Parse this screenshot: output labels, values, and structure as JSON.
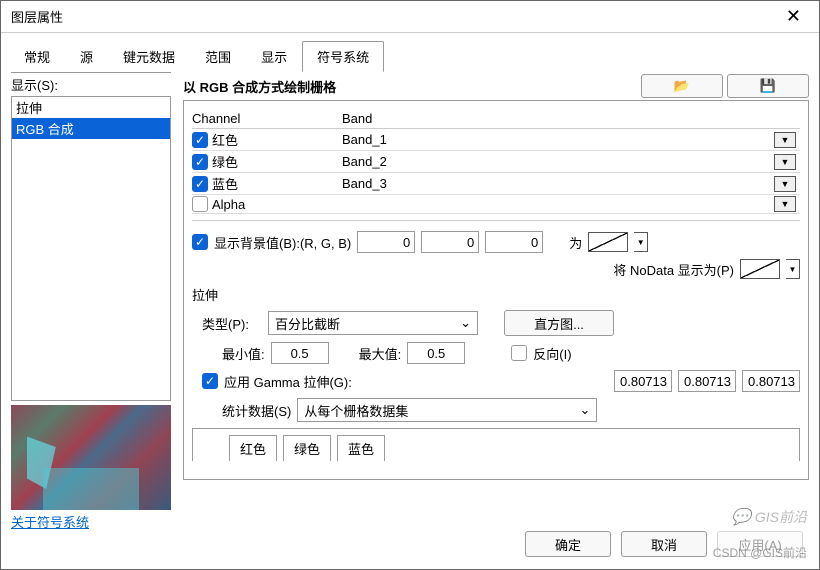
{
  "title": "图层属性",
  "tabs": [
    "常规",
    "源",
    "键元数据",
    "范围",
    "显示",
    "符号系统"
  ],
  "active_tab": "符号系统",
  "left_label": "显示(S):",
  "display_list": [
    "拉伸",
    "RGB 合成"
  ],
  "about_link": "关于符号系统",
  "panel_title": "以 RGB 合成方式绘制栅格",
  "channel_hdr": {
    "c1": "Channel",
    "c2": "Band"
  },
  "channels": [
    {
      "checked": true,
      "name": "红色",
      "band": "Band_1"
    },
    {
      "checked": true,
      "name": "绿色",
      "band": "Band_2"
    },
    {
      "checked": true,
      "name": "蓝色",
      "band": "Band_3"
    },
    {
      "checked": false,
      "name": "Alpha",
      "band": ""
    }
  ],
  "bg": {
    "chk": true,
    "label": "显示背景值(B):(R, G, B)",
    "r": "0",
    "g": "0",
    "b": "0",
    "as": "为"
  },
  "nodata_label": "将 NoData 显示为(P)",
  "stretch_label": "拉伸",
  "type_label": "类型(P):",
  "type_value": "百分比截断",
  "hist_btn": "直方图...",
  "min_label": "最小值:",
  "min_val": "0.5",
  "max_label": "最大值:",
  "max_val": "0.5",
  "invert_label": "反向(I)",
  "gamma": {
    "chk": true,
    "label": "应用 Gamma 拉伸(G):",
    "v1": "0.80713",
    "v2": "0.80713",
    "v3": "0.80713"
  },
  "stats_label": "统计数据(S)",
  "stats_combo": "从每个栅格数据集",
  "stat_tabs": [
    "红色",
    "绿色",
    "蓝色"
  ],
  "ok": "确定",
  "cancel": "取消",
  "apply": "应用(A)",
  "watermark1": "GIS前沿",
  "watermark2": "CSDN @GIS前沿",
  "icon_open": "📂",
  "icon_save": "💾"
}
